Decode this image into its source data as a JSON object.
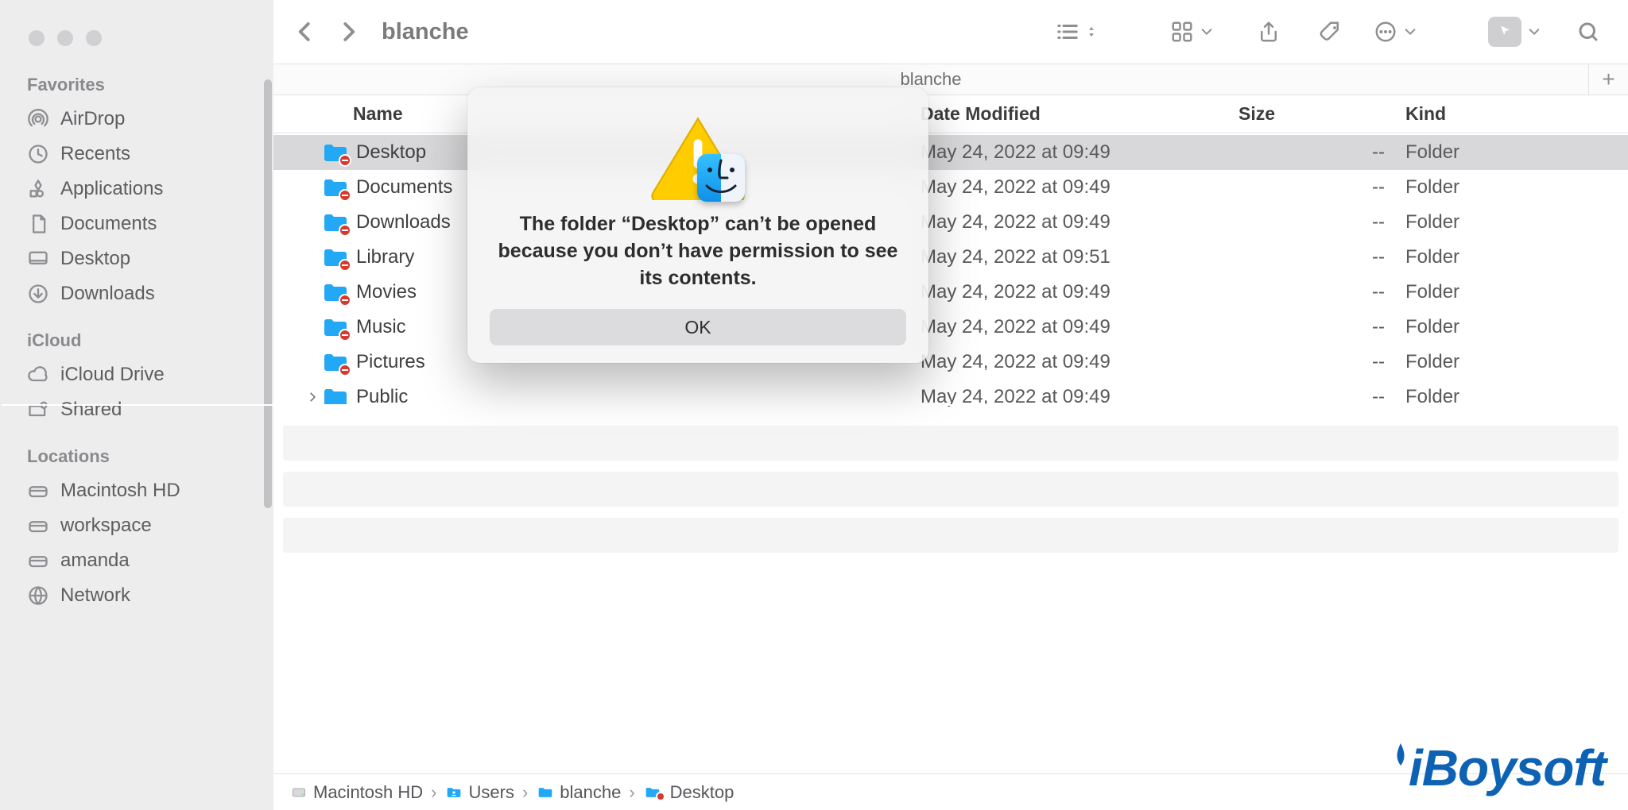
{
  "sidebar": {
    "sections": [
      {
        "heading": "Favorites",
        "items": [
          {
            "icon": "airdrop",
            "label": "AirDrop"
          },
          {
            "icon": "clock",
            "label": "Recents"
          },
          {
            "icon": "apps",
            "label": "Applications"
          },
          {
            "icon": "doc",
            "label": "Documents"
          },
          {
            "icon": "desktop",
            "label": "Desktop"
          },
          {
            "icon": "download",
            "label": "Downloads"
          }
        ]
      },
      {
        "heading": "iCloud",
        "items": [
          {
            "icon": "cloud",
            "label": "iCloud Drive"
          },
          {
            "icon": "shared",
            "label": "Shared"
          }
        ]
      },
      {
        "heading": "Locations",
        "items": [
          {
            "icon": "disk",
            "label": "Macintosh HD"
          },
          {
            "icon": "disk",
            "label": "workspace"
          },
          {
            "icon": "disk",
            "label": "amanda"
          },
          {
            "icon": "globe",
            "label": "Network"
          }
        ]
      }
    ]
  },
  "toolbar": {
    "title": "blanche"
  },
  "tabs": {
    "active": "blanche"
  },
  "columns": {
    "name": "Name",
    "date": "Date Modified",
    "size": "Size",
    "kind": "Kind"
  },
  "files": [
    {
      "name": "Desktop",
      "date": "May 24, 2022 at 09:49",
      "size": "--",
      "kind": "Folder",
      "restricted": true,
      "selected": true,
      "expandable": false
    },
    {
      "name": "Documents",
      "date": "May 24, 2022 at 09:49",
      "size": "--",
      "kind": "Folder",
      "restricted": true,
      "expandable": false
    },
    {
      "name": "Downloads",
      "date": "May 24, 2022 at 09:49",
      "size": "--",
      "kind": "Folder",
      "restricted": true,
      "expandable": false
    },
    {
      "name": "Library",
      "date": "May 24, 2022 at 09:51",
      "size": "--",
      "kind": "Folder",
      "restricted": true,
      "expandable": false
    },
    {
      "name": "Movies",
      "date": "May 24, 2022 at 09:49",
      "size": "--",
      "kind": "Folder",
      "restricted": true,
      "expandable": false
    },
    {
      "name": "Music",
      "date": "May 24, 2022 at 09:49",
      "size": "--",
      "kind": "Folder",
      "restricted": true,
      "expandable": false
    },
    {
      "name": "Pictures",
      "date": "May 24, 2022 at 09:49",
      "size": "--",
      "kind": "Folder",
      "restricted": true,
      "expandable": false
    },
    {
      "name": "Public",
      "date": "May 24, 2022 at 09:49",
      "size": "--",
      "kind": "Folder",
      "restricted": false,
      "expandable": true
    }
  ],
  "path": [
    "Macintosh HD",
    "Users",
    "blanche",
    "Desktop"
  ],
  "dialog": {
    "message": "The folder “Desktop” can’t be opened because you don’t have permission to see its contents.",
    "ok": "OK"
  },
  "watermark": "iBoysoft"
}
